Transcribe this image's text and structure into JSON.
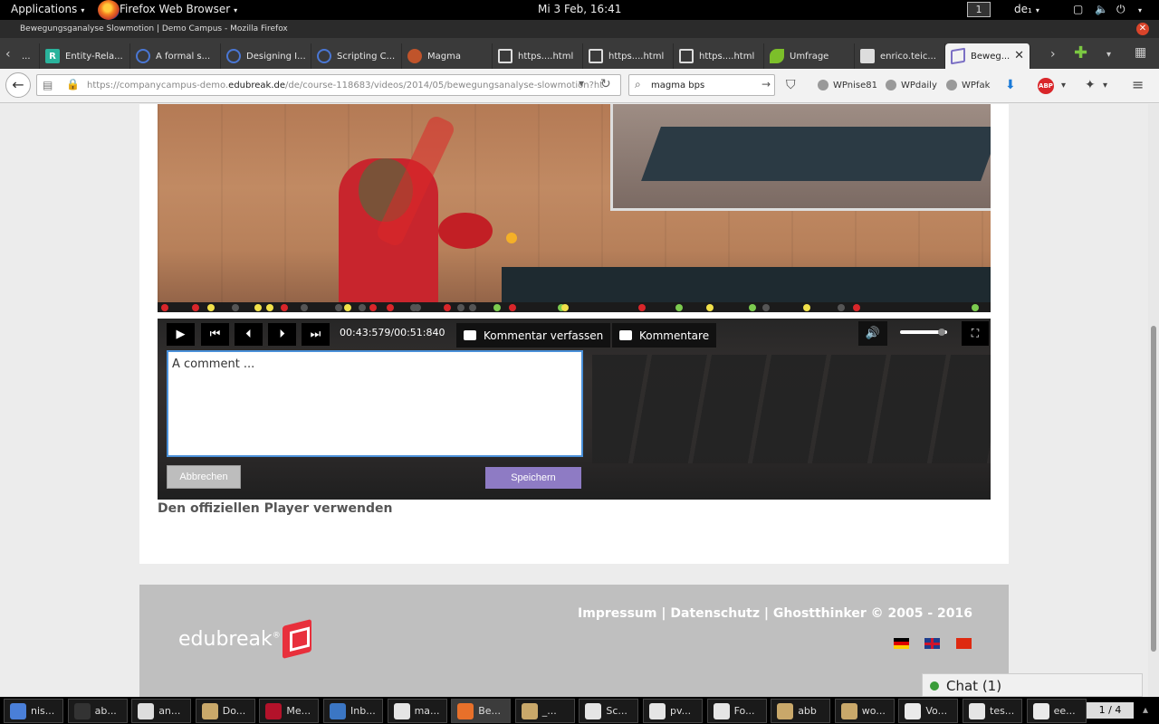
{
  "topbar": {
    "applications": "Applications",
    "app_name": "Firefox Web Browser",
    "clock": "Mi 3 Feb, 16:41",
    "workspace": "1",
    "keyboard": "de₁"
  },
  "window": {
    "title": "Bewegungsganalyse Slowmotion | Demo Campus - Mozilla Firefox"
  },
  "tabs": [
    {
      "label": "...",
      "icon": "generic-tab-icon"
    },
    {
      "label": "Entity-Rela...",
      "icon": "researchgate-icon"
    },
    {
      "label": "A formal s...",
      "icon": "scholar-icon"
    },
    {
      "label": "Designing I...",
      "icon": "scholar-icon"
    },
    {
      "label": "Scripting C...",
      "icon": "scholar-icon"
    },
    {
      "label": "Magma",
      "icon": "magma-icon"
    },
    {
      "label": "https....html",
      "icon": "hourglass-icon"
    },
    {
      "label": "https....html",
      "icon": "hourglass-icon"
    },
    {
      "label": "https....html",
      "icon": "hourglass-icon"
    },
    {
      "label": "Umfrage",
      "icon": "leaf-icon"
    },
    {
      "label": "enrico.teic...",
      "icon": "page-icon"
    },
    {
      "label": "Beweg...",
      "icon": "edubreak-icon",
      "active": true
    }
  ],
  "navbar": {
    "url_prefix": "https://companycampus-demo.",
    "url_domain": "edubreak.de",
    "url_path": "/de/course-118683/videos/2014/05/bewegungsanalyse-slowmotion?ht",
    "search_query": "magma bps",
    "bookmarks": [
      "WPnise81",
      "WPdaily",
      "WPfak"
    ]
  },
  "player": {
    "time": "00:43:579/00:51:840",
    "write_comment": "Kommentar verfassen",
    "comments": "Kommentare",
    "comment_placeholder": "A comment ...",
    "cancel": "Abbrechen",
    "save": "Speichern",
    "volume_level": 0.85,
    "timeline_colors": {
      "red": "#d9262a",
      "yellow": "#f1e14a",
      "green": "#7ccb4f",
      "grey": "#555555"
    }
  },
  "official_player_link": "Den offiziellen Player verwenden",
  "footer": {
    "impressum": "Impressum",
    "datenschutz": "Datenschutz",
    "copyright": "Ghostthinker © 2005 - 2016",
    "separator": "|",
    "logo_text": "edubreak",
    "logo_reg": "®"
  },
  "chat": {
    "label": "Chat (1)"
  },
  "taskbar": {
    "items": [
      {
        "label": "nis...",
        "icon": "chromium-icon"
      },
      {
        "label": "ab...",
        "icon": "terminal-icon"
      },
      {
        "label": "an...",
        "icon": "text-editor-icon"
      },
      {
        "label": "Do...",
        "icon": "file-manager-icon"
      },
      {
        "label": "Me...",
        "icon": "mendeley-icon"
      },
      {
        "label": "Inb...",
        "icon": "mail-icon"
      },
      {
        "label": "ma...",
        "icon": "document-viewer-icon"
      },
      {
        "label": "Be...",
        "icon": "firefox-icon",
        "active": true
      },
      {
        "label": "_...",
        "icon": "file-manager-icon"
      },
      {
        "label": "Sc...",
        "icon": "document-viewer-icon"
      },
      {
        "label": "pv...",
        "icon": "document-viewer-icon"
      },
      {
        "label": "Fo...",
        "icon": "document-viewer-icon"
      },
      {
        "label": "abb",
        "icon": "file-manager-icon"
      },
      {
        "label": "wo...",
        "icon": "file-manager-icon"
      },
      {
        "label": "Vo...",
        "icon": "writer-icon"
      },
      {
        "label": "tes...",
        "icon": "document-viewer-icon"
      },
      {
        "label": "ee...",
        "icon": "writer-icon"
      }
    ],
    "pager": "1 / 4"
  }
}
